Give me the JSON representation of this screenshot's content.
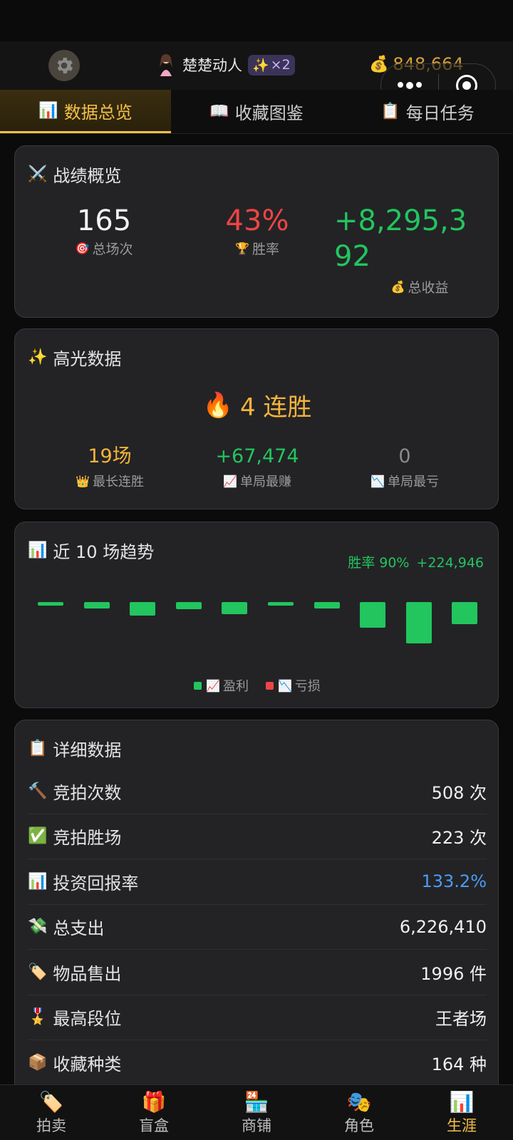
{
  "header": {
    "username": "楚楚动人",
    "badge_icon": "✨",
    "badge_text": "×2",
    "coins_icon": "💰",
    "coins": "848,664"
  },
  "tabs": [
    {
      "icon": "📊",
      "label": "数据总览",
      "active": true
    },
    {
      "icon": "📖",
      "label": "收藏图鉴",
      "active": false
    },
    {
      "icon": "📋",
      "label": "每日任务",
      "active": false
    }
  ],
  "overview": {
    "icon": "⚔️",
    "title": "战绩概览",
    "total_games": "165",
    "total_games_icon": "🎯",
    "total_games_label": "总场次",
    "win_rate": "43%",
    "win_rate_icon": "🏆",
    "win_rate_label": "胜率",
    "total_profit_line1": "+8,295,3",
    "total_profit_line2": "92",
    "total_profit_icon": "💰",
    "total_profit_label": "总收益"
  },
  "highlights": {
    "icon": "✨",
    "title": "高光数据",
    "streak_icon": "🔥",
    "streak_text": "4 连胜",
    "longest_streak": "19场",
    "longest_streak_icon": "👑",
    "longest_streak_label": "最长连胜",
    "best_single": "+67,474",
    "best_single_icon": "📈",
    "best_single_label": "单局最赚",
    "worst_single": "0",
    "worst_single_icon": "📉",
    "worst_single_label": "单局最亏"
  },
  "trend": {
    "icon": "📊",
    "title": "近 10 场趋势",
    "win_rate": "胜率 90%",
    "profit": "+224,946",
    "legend_profit_icon": "📈",
    "legend_profit": "盈利",
    "legend_loss_icon": "📉",
    "legend_loss": "亏损",
    "profit_color": "#22c55e",
    "loss_color": "#ef4444"
  },
  "chart_data": {
    "type": "bar",
    "note_colors": {
      "profit": "#22c55e",
      "loss": "#ef4444"
    },
    "values": [
      3,
      5,
      11,
      6,
      10,
      3,
      5,
      21,
      34,
      18
    ],
    "all_profit": true
  },
  "details": {
    "icon": "📋",
    "title": "详细数据",
    "rows": [
      {
        "icon": "🔨",
        "label": "竞拍次数",
        "value": "508 次"
      },
      {
        "icon": "✅",
        "label": "竞拍胜场",
        "value": "223 次"
      },
      {
        "icon": "📊",
        "label": "投资回报率",
        "value": "133.2%"
      },
      {
        "icon": "💸",
        "label": "总支出",
        "value": "6,226,410"
      },
      {
        "icon": "🏷️",
        "label": "物品售出",
        "value": "1996 件"
      },
      {
        "icon": "🎖️",
        "label": "最高段位",
        "value": "王者场"
      },
      {
        "icon": "📦",
        "label": "收藏种类",
        "value": "164 种"
      }
    ]
  },
  "bottom_nav": [
    {
      "icon": "🏷️",
      "label": "拍卖",
      "active": false
    },
    {
      "icon": "🎁",
      "label": "盲盒",
      "active": false
    },
    {
      "icon": "🏪",
      "label": "商铺",
      "active": false
    },
    {
      "icon": "🎭",
      "label": "角色",
      "active": false
    },
    {
      "icon": "📊",
      "label": "生涯",
      "active": true
    }
  ]
}
